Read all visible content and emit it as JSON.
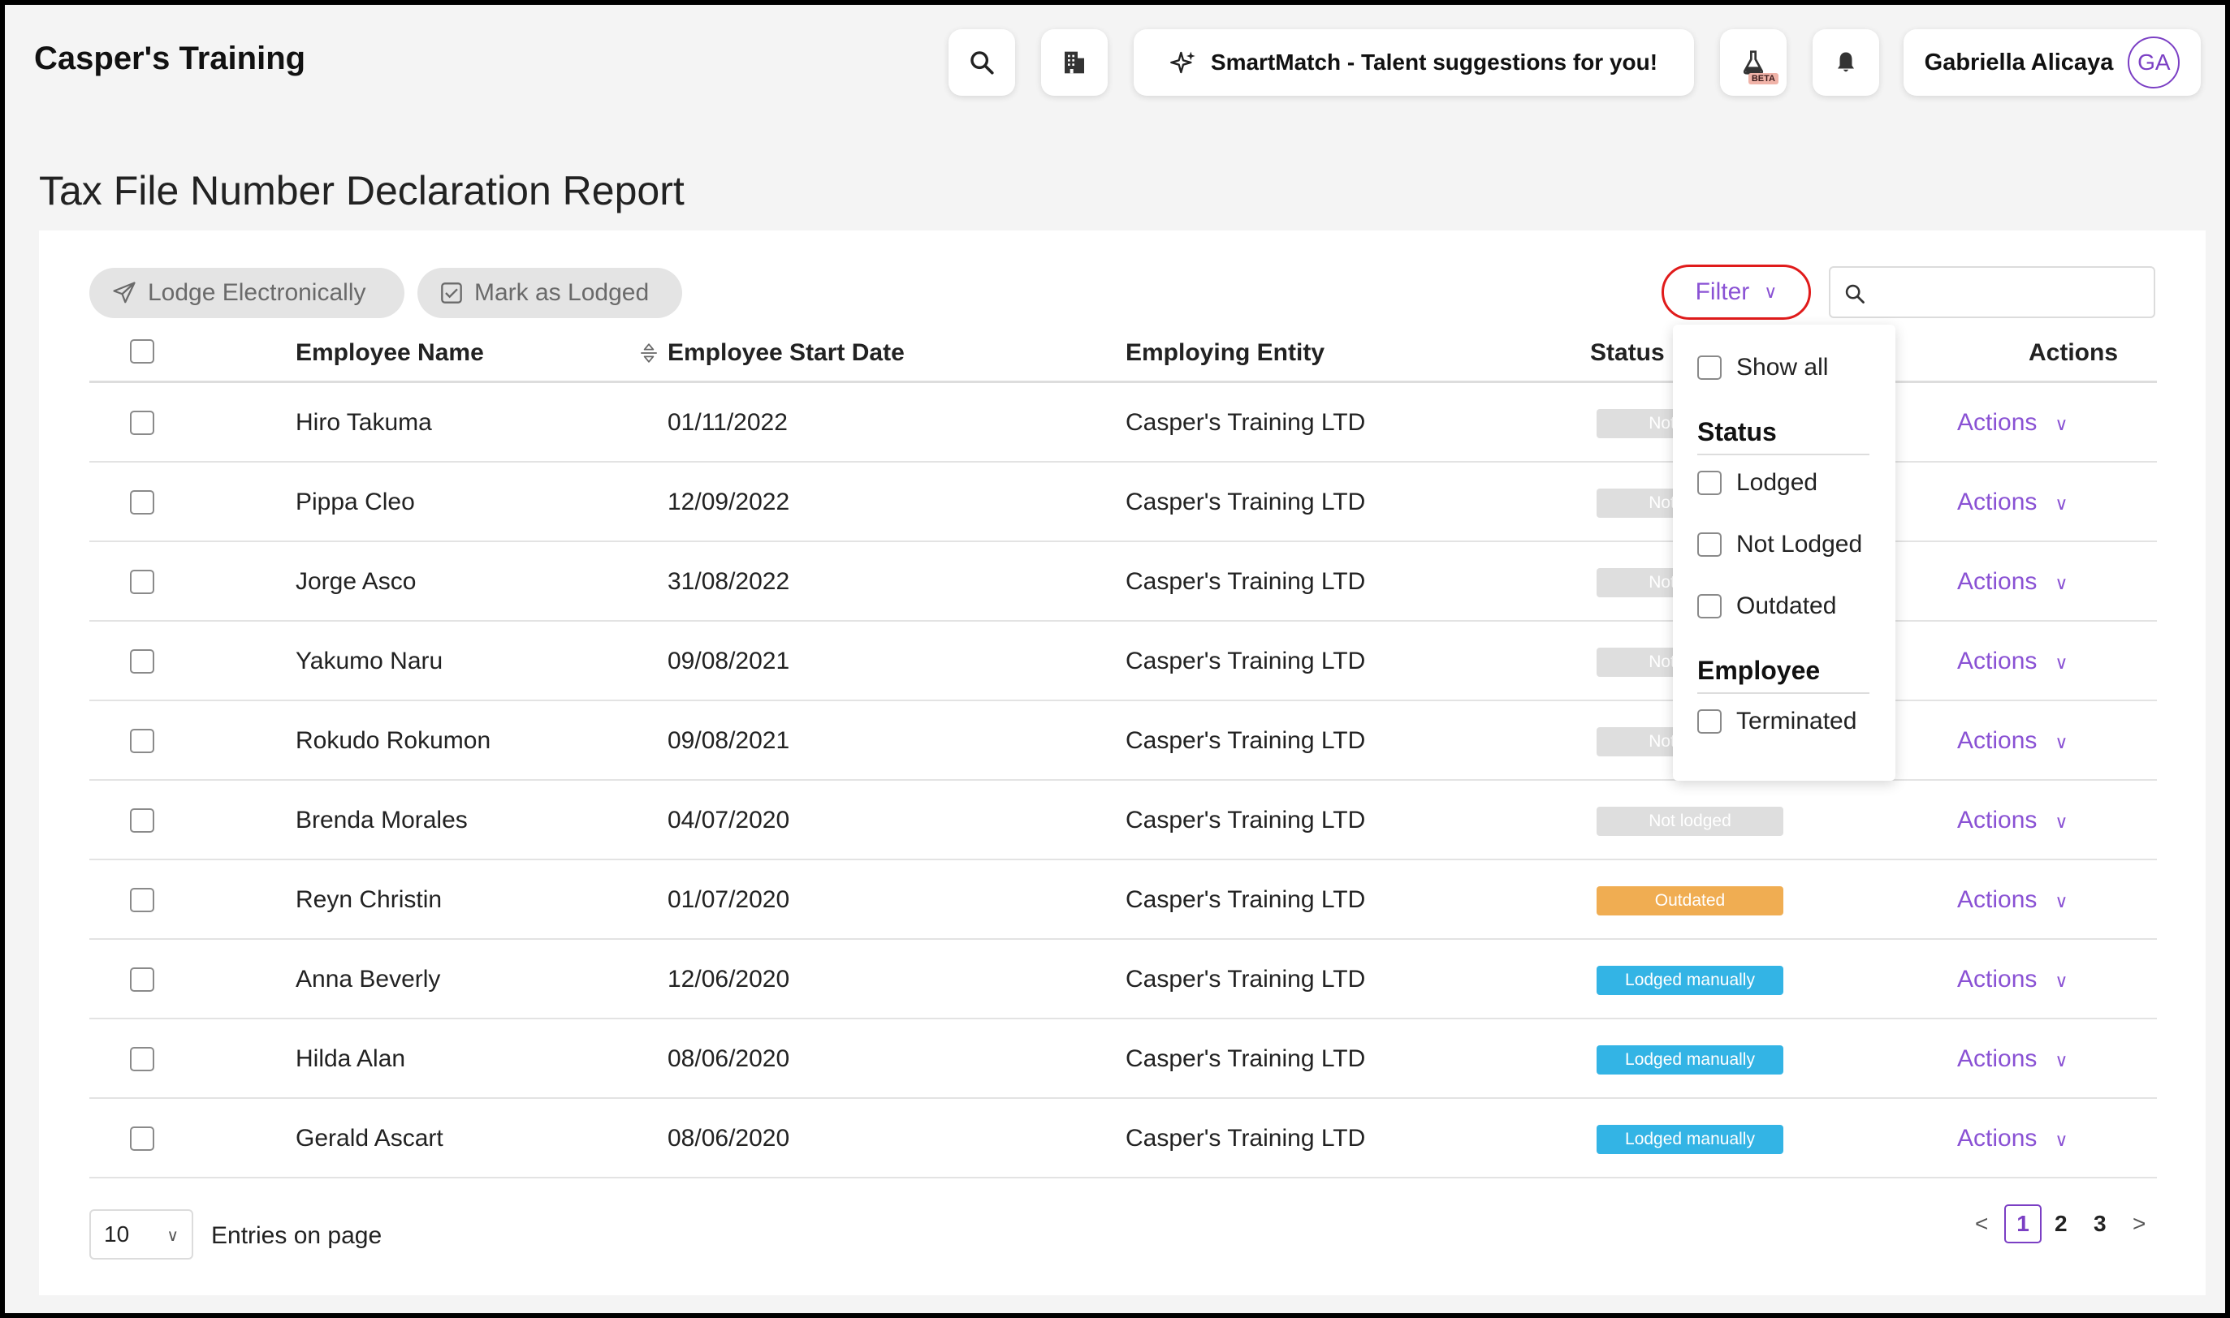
{
  "app": {
    "title": "Casper's Training"
  },
  "topbar": {
    "search_icon": "search-icon",
    "building_icon": "building-icon",
    "smartmatch_label": "SmartMatch - Talent suggestions for you!",
    "beta_label": "BETA",
    "user_name": "Gabriella Alicaya",
    "user_initials": "GA"
  },
  "page": {
    "title": "Tax File Number Declaration Report"
  },
  "toolbar": {
    "lodge_label": "Lodge Electronically",
    "mark_label": "Mark as Lodged",
    "filter_label": "Filter",
    "search_value": "",
    "search_placeholder": ""
  },
  "table": {
    "headers": {
      "name": "Employee Name",
      "start_date": "Employee Start Date",
      "entity": "Employing Entity",
      "status": "Status",
      "actions": "Actions"
    },
    "rows": [
      {
        "name": "Hiro Takuma",
        "start_date": "01/11/2022",
        "entity": "Casper's Training LTD",
        "status": "Not lodged",
        "status_type": "not_lodged",
        "action": "Actions"
      },
      {
        "name": "Pippa Cleo",
        "start_date": "12/09/2022",
        "entity": "Casper's Training LTD",
        "status": "Not lodged",
        "status_type": "not_lodged",
        "action": "Actions"
      },
      {
        "name": "Jorge Asco",
        "start_date": "31/08/2022",
        "entity": "Casper's Training LTD",
        "status": "Not lodged",
        "status_type": "not_lodged",
        "action": "Actions"
      },
      {
        "name": "Yakumo Naru",
        "start_date": "09/08/2021",
        "entity": "Casper's Training LTD",
        "status": "Not lodged",
        "status_type": "not_lodged",
        "action": "Actions"
      },
      {
        "name": "Rokudo Rokumon",
        "start_date": "09/08/2021",
        "entity": "Casper's Training LTD",
        "status": "Not lodged",
        "status_type": "not_lodged",
        "action": "Actions"
      },
      {
        "name": "Brenda Morales",
        "start_date": "04/07/2020",
        "entity": "Casper's Training LTD",
        "status": "Not lodged",
        "status_type": "not_lodged",
        "action": "Actions"
      },
      {
        "name": "Reyn Christin",
        "start_date": "01/07/2020",
        "entity": "Casper's Training LTD",
        "status": "Outdated",
        "status_type": "outdated",
        "action": "Actions"
      },
      {
        "name": "Anna Beverly",
        "start_date": "12/06/2020",
        "entity": "Casper's Training LTD",
        "status": "Lodged manually",
        "status_type": "lodged",
        "action": "Actions"
      },
      {
        "name": "Hilda Alan",
        "start_date": "08/06/2020",
        "entity": "Casper's Training LTD",
        "status": "Lodged manually",
        "status_type": "lodged",
        "action": "Actions"
      },
      {
        "name": "Gerald Ascart",
        "start_date": "08/06/2020",
        "entity": "Casper's Training LTD",
        "status": "Lodged manually",
        "status_type": "lodged",
        "action": "Actions"
      }
    ]
  },
  "filter_menu": {
    "show_all": "Show all",
    "status_heading": "Status",
    "lodged": "Lodged",
    "not_lodged": "Not Lodged",
    "outdated": "Outdated",
    "employee_heading": "Employee",
    "terminated": "Terminated"
  },
  "footer": {
    "entries_value": "10",
    "entries_label": "Entries on page",
    "pages": [
      "1",
      "2",
      "3"
    ],
    "current_page": "1",
    "prev": "<",
    "next": ">"
  },
  "colors": {
    "accent": "#8a52d4",
    "not_lodged": "#dedede",
    "outdated": "#f0ad52",
    "lodged": "#33b4e5",
    "filter_highlight": "#e01b1b"
  }
}
